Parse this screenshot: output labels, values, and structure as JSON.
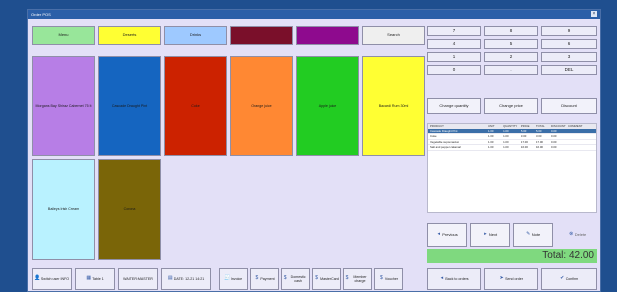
{
  "window": {
    "title": "Order POS"
  },
  "categories": [
    {
      "label": "Menu",
      "color": "#98e69a"
    },
    {
      "label": "Deserts",
      "color": "#ffff33"
    },
    {
      "label": "Drinks",
      "color": "#9ec9ff"
    },
    {
      "label": "",
      "color": "#7a0f2a"
    },
    {
      "label": "",
      "color": "#8e0a8e"
    }
  ],
  "search_label": "Search",
  "products": [
    {
      "label": "Morgans Bay Shiraz Cabernet 75 lt",
      "color": "#b77ee6"
    },
    {
      "label": "Cascade Draught Pint",
      "color": "#1565c0"
    },
    {
      "label": "Coke",
      "color": "#cc2200"
    },
    {
      "label": "Orange juice",
      "color": "#ff8833"
    },
    {
      "label": "Apple juice",
      "color": "#22cc22"
    },
    {
      "label": "Bacardi Rum 30ml",
      "color": "#ffff33"
    },
    {
      "label": "Baileys Irish Cream",
      "color": "#b9f2ff"
    },
    {
      "label": "Corona",
      "color": "#7a6508"
    }
  ],
  "keypad": [
    "7",
    "8",
    "9",
    "4",
    "5",
    "6",
    "1",
    "2",
    "3",
    "0",
    ".",
    "DEL"
  ],
  "actions": [
    "Change quantity",
    "Change price",
    "Discount"
  ],
  "table": {
    "headers": [
      "PRODUCT",
      "UNIT",
      "QUANTITY",
      "PRICE",
      "TOTAL",
      "DISCOUNT",
      "COMMENT"
    ],
    "rows": [
      [
        "Cascade Draught Pint",
        "1.00",
        "1.00",
        "5.00",
        "5.00",
        "0.00",
        ""
      ],
      [
        "Coke",
        "1.00",
        "1.00",
        "3.00",
        "3.00",
        "0.00",
        ""
      ],
      [
        "Vegetable supremacion",
        "1.00",
        "1.00",
        "17.00",
        "17.00",
        "0.00",
        ""
      ],
      [
        "Salt and pepper calamari",
        "1.00",
        "1.00",
        "16.00",
        "16.00",
        "0.00",
        ""
      ]
    ]
  },
  "nav": {
    "previous": "Previous",
    "next": "Next",
    "note": "Note",
    "delete": "Delete"
  },
  "total": "Total: 42.00",
  "bottom": {
    "switch_user": "Switch user INFO",
    "table": "Table 1",
    "waiter": "WAITER:MASTER",
    "date": "DATE: 12-21 14:21",
    "invoice": "Invoice",
    "payment": "Payment",
    "domestic": "Domestic cash",
    "mastercard": "MasterCard",
    "member": "Member charge",
    "voucher": "Voucher",
    "back": "Back to orders",
    "send": "Send order",
    "confirm": "Confirm"
  }
}
